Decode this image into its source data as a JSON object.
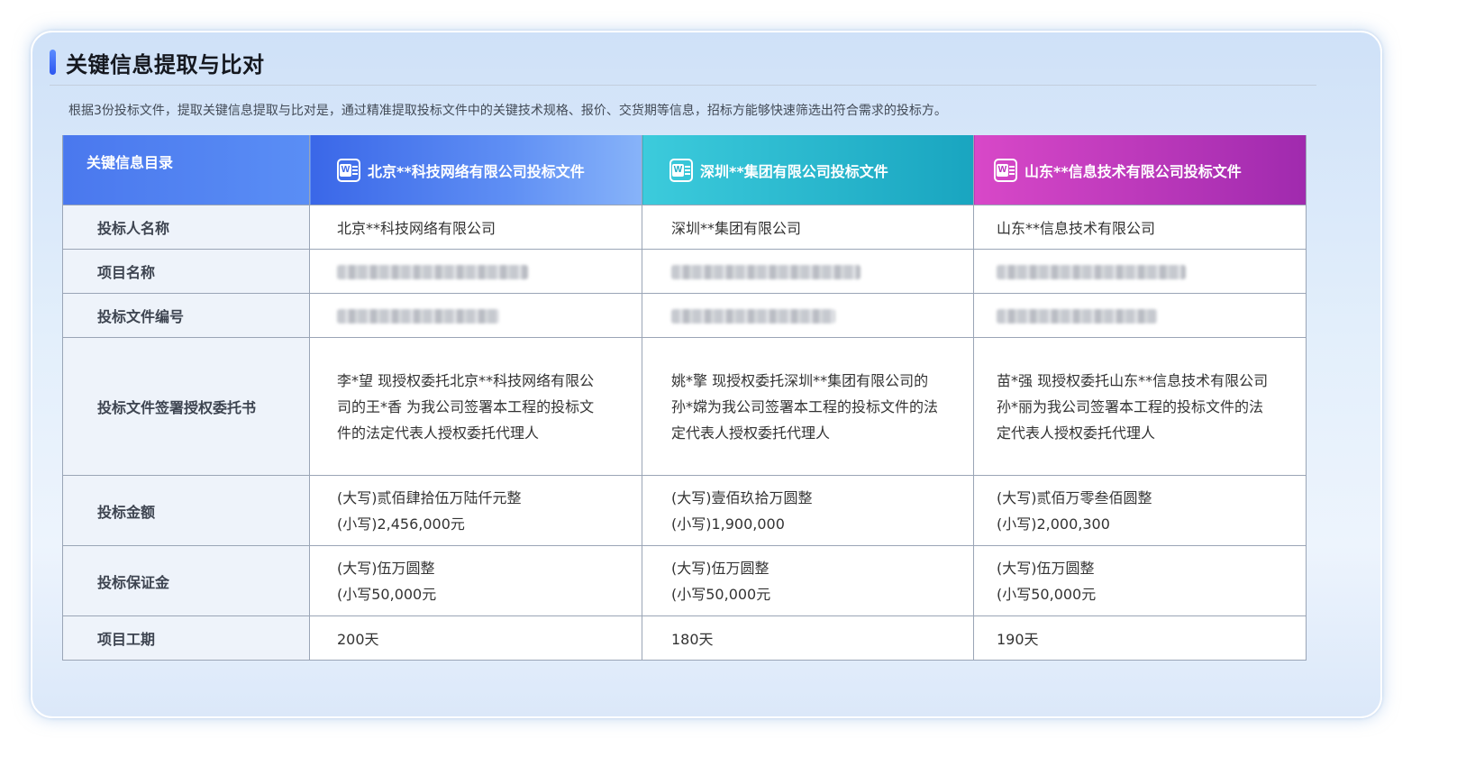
{
  "section": {
    "title": "关键信息提取与比对",
    "description": "根据3份投标文件，提取关键信息提取与比对是，通过精准提取投标文件中的关键技术规格、报价、交货期等信息，招标方能够快速筛选出符合需求的投标方。"
  },
  "table": {
    "headers": {
      "catalog": "关键信息目录",
      "file1": "北京**科技网络有限公司投标文件",
      "file2": "深圳**集团有限公司投标文件",
      "file3": "山东**信息技术有限公司投标文件"
    },
    "header_icon": "word-doc-icon",
    "header_colors": {
      "file1": "#4f7ff0",
      "file2": "#24b3c9",
      "file3": "#c13cbe"
    },
    "rows": {
      "bidder": {
        "label": "投标人名称",
        "c1": "北京**科技网络有限公司",
        "c2": "深圳**集团有限公司",
        "c3": "山东**信息技术有限公司"
      },
      "project": {
        "label": "项目名称"
      },
      "docno": {
        "label": "投标文件编号"
      },
      "auth": {
        "label": "投标文件签署授权委托书",
        "c1": "李*望  现授权委托北京**科技网络有限公司的王*香 为我公司签署本工程的投标文件的法定代表人授权委托代理人",
        "c2": "姚*擎  现授权委托深圳**集团有限公司的孙*嫦为我公司签署本工程的投标文件的法定代表人授权委托代理人",
        "c3": "苗*强  现授权委托山东**信息技术有限公司孙*丽为我公司签署本工程的投标文件的法定代表人授权委托代理人"
      },
      "amount": {
        "label": "投标金额",
        "c1": {
          "upper": "(大写)贰佰肆拾伍万陆仟元整",
          "lower": "(小写)2,456,000元"
        },
        "c2": {
          "upper": "(大写)壹佰玖拾万圆整",
          "lower": "(小写)1,900,000"
        },
        "c3": {
          "upper": "(大写)贰佰万零叁佰圆整",
          "lower": "(小写)2,000,300"
        }
      },
      "deposit": {
        "label": "投标保证金",
        "c1": {
          "upper": "(大写)伍万圆整",
          "lower": "(小写50,000元"
        },
        "c2": {
          "upper": "(大写)伍万圆整",
          "lower": "(小写50,000元"
        },
        "c3": {
          "upper": "(大写)伍万圆整",
          "lower": "(小写50,000元"
        }
      },
      "period": {
        "label": "项目工期",
        "c1": "200天",
        "c2": "180天",
        "c3": "190天"
      }
    }
  }
}
